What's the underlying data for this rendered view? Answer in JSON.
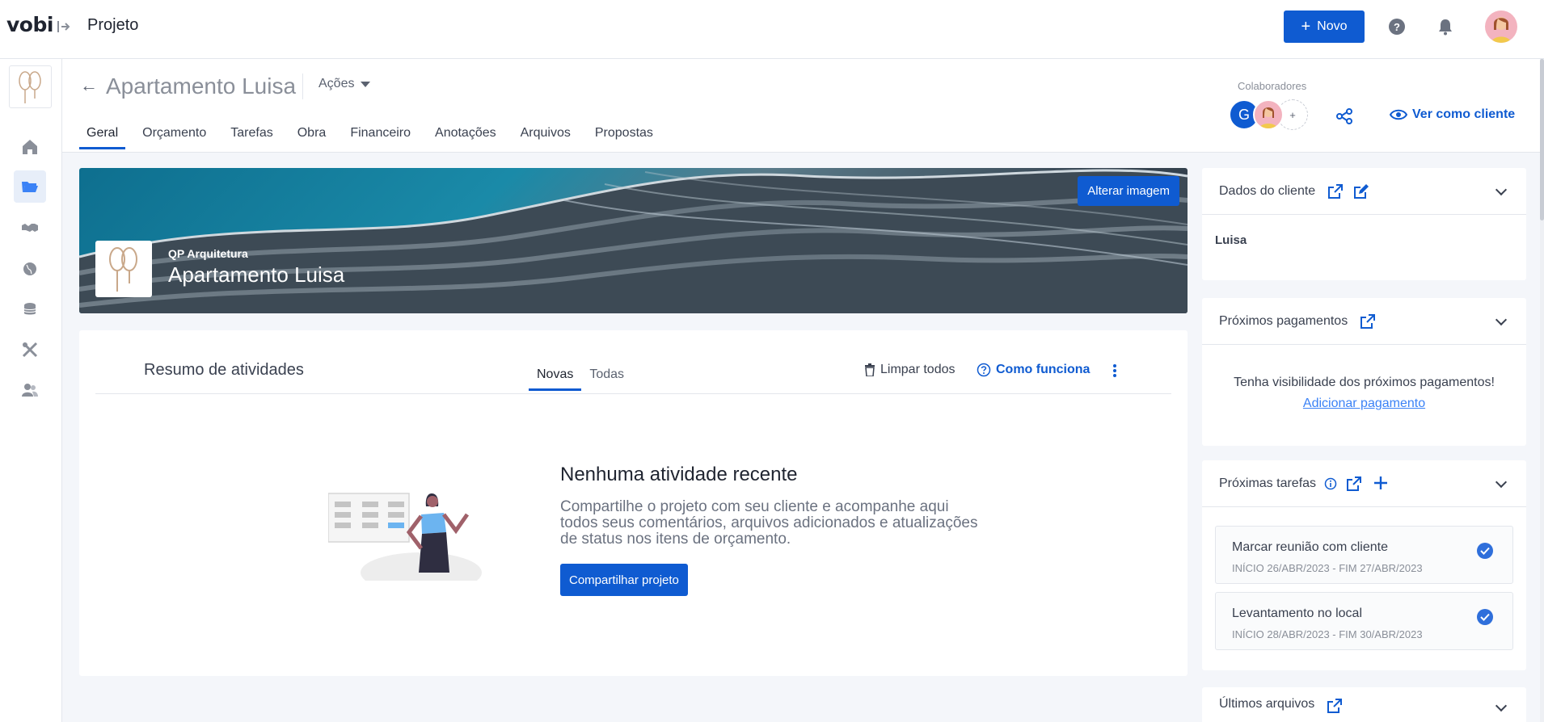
{
  "app": {
    "logo": "vobi",
    "section_title": "Projeto",
    "new_button": "Novo"
  },
  "colors": {
    "primary": "#0f5bd1",
    "background": "#f4f6fa",
    "active_nav": "#e7eef9"
  },
  "sidebar": {
    "items": [
      {
        "name": "home-icon",
        "active": false
      },
      {
        "name": "folder-icon",
        "active": true
      },
      {
        "name": "handshake-icon",
        "active": false
      },
      {
        "name": "globe-icon",
        "active": false
      },
      {
        "name": "coins-icon",
        "active": false
      },
      {
        "name": "tools-icon",
        "active": false
      },
      {
        "name": "users-icon",
        "active": false
      }
    ]
  },
  "project": {
    "name": "Apartamento Luisa",
    "actions_label": "Ações",
    "tabs": [
      "Geral",
      "Orçamento",
      "Tarefas",
      "Obra",
      "Financeiro",
      "Anotações",
      "Arquivos",
      "Propostas"
    ],
    "active_tab": "Geral",
    "collaborators_label": "Colaboradores",
    "collaborator_initial": "G",
    "add_collaborator": "+",
    "view_as_client": "Ver como cliente"
  },
  "banner": {
    "change_image": "Alterar imagem",
    "company": "QP Arquitetura",
    "title": "Apartamento Luisa"
  },
  "activity": {
    "title": "Resumo de atividades",
    "tabs": [
      "Novas",
      "Todas"
    ],
    "active_tab": "Novas",
    "clear_all": "Limpar todos",
    "how_it_works": "Como funciona",
    "empty_title": "Nenhuma atividade recente",
    "empty_description": "Compartilhe o projeto com seu cliente e acompanhe aqui todos seus comentários, arquivos adicionados e atualizações de status nos itens de orçamento.",
    "share_button": "Compartilhar projeto"
  },
  "right_panel": {
    "client": {
      "title": "Dados do cliente",
      "name": "Luisa"
    },
    "payments": {
      "title": "Próximos pagamentos",
      "empty_text": "Tenha visibilidade dos próximos pagamentos!",
      "add_link": "Adicionar pagamento"
    },
    "tasks": {
      "title": "Próximas tarefas",
      "items": [
        {
          "name": "Marcar reunião com cliente",
          "dates": "INÍCIO 26/ABR/2023 - FIM 27/ABR/2023"
        },
        {
          "name": "Levantamento no local",
          "dates": "INÍCIO 28/ABR/2023 - FIM 30/ABR/2023"
        }
      ]
    },
    "files": {
      "title": "Últimos arquivos"
    }
  }
}
